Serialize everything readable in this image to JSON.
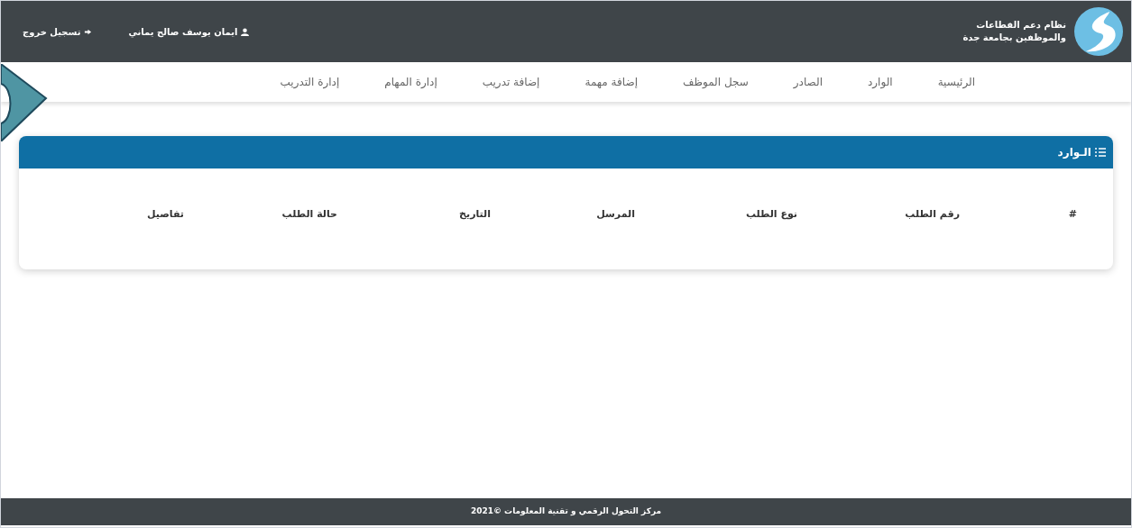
{
  "header": {
    "logo_text": [
      "نظام دعم القطاعات",
      "والموظفين بجامعة جدة"
    ],
    "user": "ايمان يوسف صالح يماني",
    "logout": "تسجيل خروج"
  },
  "nav": [
    "الرئيسية",
    "الوارد",
    "الصادر",
    "سجل الموظف",
    "إضافة مهمة",
    "إضافة تدريب",
    "إدارة المهام",
    "إدارة التدريب"
  ],
  "panel": {
    "title": "الـوارد",
    "columns": [
      "#",
      "رقم الطلب",
      "نوع الطلب",
      "المرسل",
      "التاريخ",
      "حالة الطلب",
      "تفاصيل"
    ]
  },
  "footer": "مركز التحول الرقمي و تقنية المعلومات ©2021"
}
